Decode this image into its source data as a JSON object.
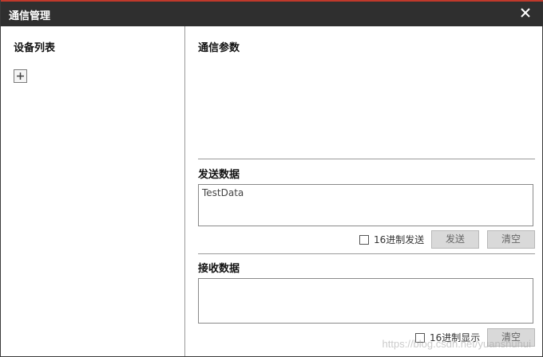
{
  "window": {
    "title": "通信管理",
    "accent_color": "#c0392b",
    "titlebar_color": "#2f2f2f",
    "close_icon": "close-icon"
  },
  "left": {
    "title": "设备列表",
    "add_icon": "plus-icon"
  },
  "right": {
    "params_title": "通信参数",
    "send": {
      "title": "发送数据",
      "text": "TestData",
      "hex_label": "16进制发送",
      "send_label": "发送",
      "clear_label": "清空"
    },
    "receive": {
      "title": "接收数据",
      "text": "",
      "hex_label": "16进制显示",
      "clear_label": "清空"
    }
  },
  "watermark": "https://blog.csdn.net/yuanshuhui"
}
